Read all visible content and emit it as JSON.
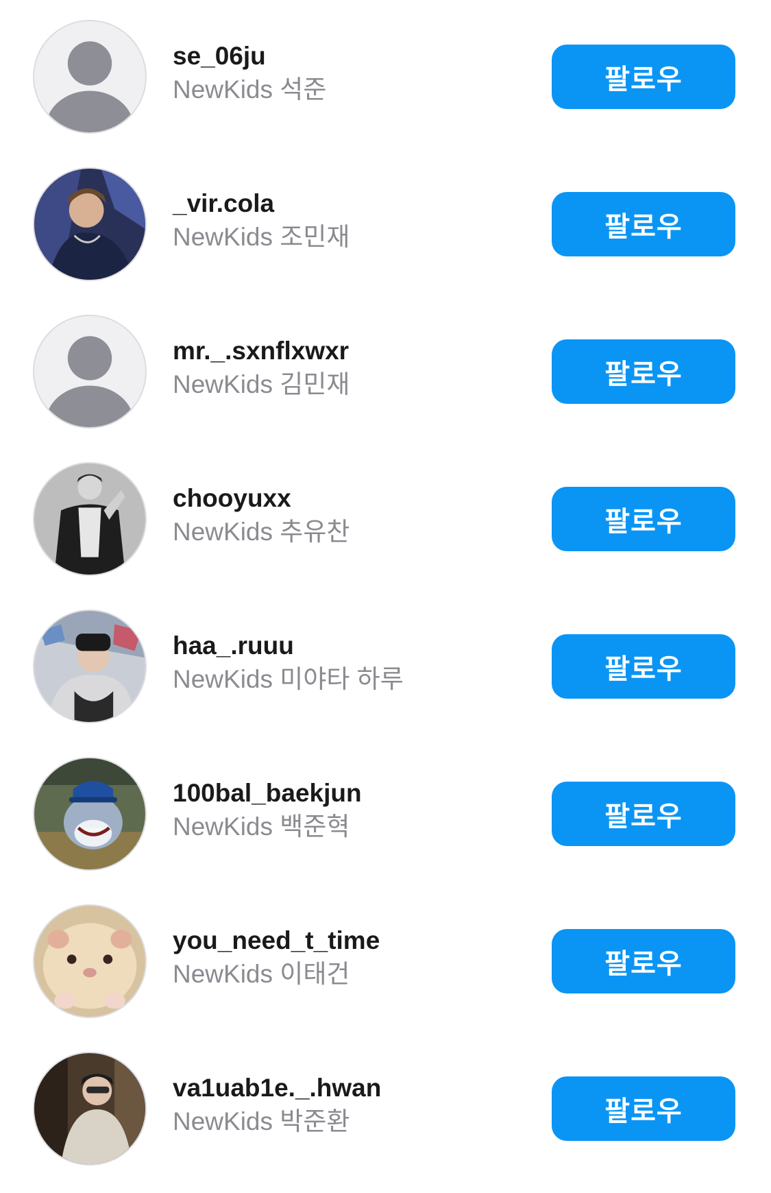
{
  "colors": {
    "follow_button": "#0a95f5",
    "username_text": "#1a1a1a",
    "fullname_text": "#8a8a90",
    "background": "#ffffff"
  },
  "follow_label": "팔로우",
  "users": [
    {
      "username": "se_06ju",
      "fullname": "NewKids 석준",
      "avatar": "default-avatar-icon"
    },
    {
      "username": "_vir.cola",
      "fullname": "NewKids 조민재",
      "avatar": "profile-photo"
    },
    {
      "username": "mr._.sxnflxwxr",
      "fullname": "NewKids 김민재",
      "avatar": "default-avatar-icon"
    },
    {
      "username": "chooyuxx",
      "fullname": "NewKids 추유찬",
      "avatar": "profile-photo"
    },
    {
      "username": "haa_.ruuu",
      "fullname": "NewKids 미야타 하루",
      "avatar": "profile-photo"
    },
    {
      "username": "100bal_baekjun",
      "fullname": "NewKids 백준혁",
      "avatar": "profile-photo"
    },
    {
      "username": "you_need_t_time",
      "fullname": "NewKids 이태건",
      "avatar": "profile-photo"
    },
    {
      "username": "va1uab1e._.hwan",
      "fullname": "NewKids 박준환",
      "avatar": "profile-photo"
    }
  ]
}
